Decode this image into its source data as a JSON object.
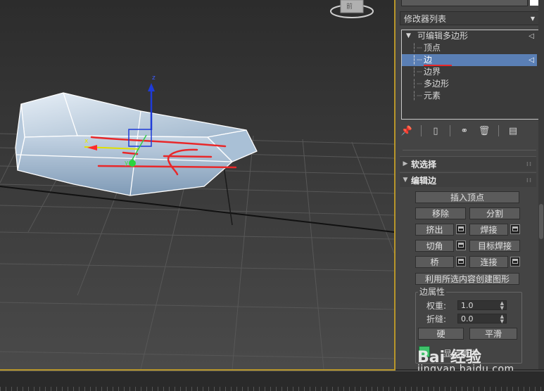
{
  "modifier_list": {
    "label": "修改器列表"
  },
  "stack": {
    "root": "可编辑多边形",
    "items": [
      "顶点",
      "边",
      "边界",
      "多边形",
      "元素"
    ],
    "selected": "边"
  },
  "rollouts": {
    "soft_selection": "软选择",
    "edit_edges": "编辑边"
  },
  "buttons": {
    "insert_vertex": "插入顶点",
    "remove": "移除",
    "split": "分割",
    "extrude": "挤出",
    "weld": "焊接",
    "chamfer": "切角",
    "target_weld": "目标焊接",
    "bridge": "桥",
    "connect": "连接",
    "create_shape": "利用所选内容创建图形",
    "hard": "硬",
    "smooth": "平滑"
  },
  "edge_properties": {
    "title": "边属性",
    "weight_label": "权重:",
    "weight_value": "1.0",
    "crease_label": "折缝:",
    "crease_value": "0.0",
    "display_label": "显示硬边"
  },
  "gizmo": {
    "x": "x",
    "y": "y",
    "z": "z"
  },
  "viewcube": {
    "label": "前"
  },
  "watermark": {
    "logo": "Bai 经验",
    "url": "jingyan.baidu.com"
  },
  "colors": {
    "selection": "#5a7fb5",
    "viewport_border": "#b8962a",
    "annotation": "#e8282a"
  }
}
